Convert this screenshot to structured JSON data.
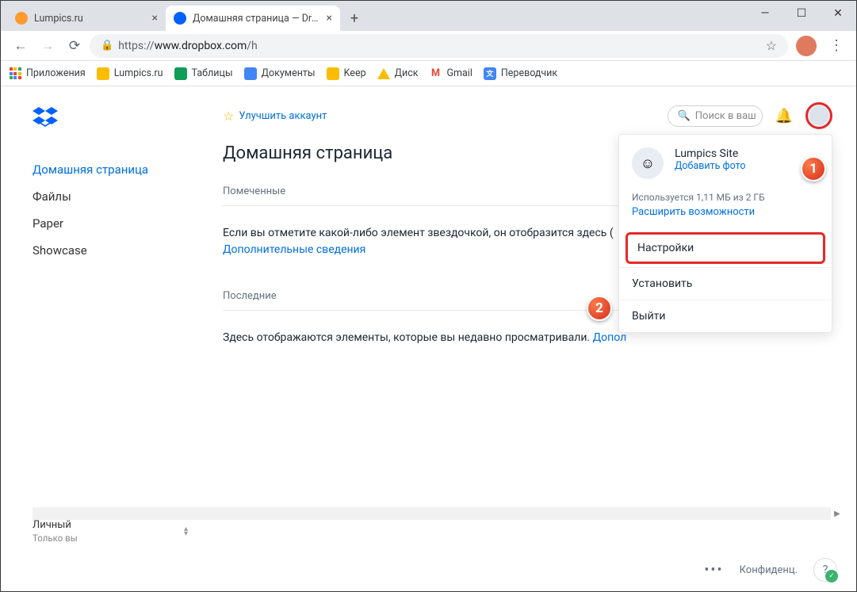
{
  "window": {
    "minimize": "—",
    "maximize": "☐",
    "close": "✕"
  },
  "tabs": [
    {
      "title": "Lumpics.ru",
      "active": false,
      "favicon_color": "#ff9a2e"
    },
    {
      "title": "Домашняя страница — Dropbox",
      "active": true,
      "favicon_color": "#0061ff"
    }
  ],
  "new_tab_glyph": "+",
  "toolbar": {
    "back": "←",
    "forward": "→",
    "reload": "⟳",
    "star": "☆",
    "menu": "⋮"
  },
  "address": {
    "scheme": "https://",
    "host": "www.dropbox.com",
    "path": "/h"
  },
  "bookmarks": [
    {
      "label": "Приложения",
      "kind": "apps"
    },
    {
      "label": "Lumpics.ru",
      "kind": "yellow"
    },
    {
      "label": "Таблицы",
      "kind": "sheets"
    },
    {
      "label": "Документы",
      "kind": "docs"
    },
    {
      "label": "Keep",
      "kind": "keep"
    },
    {
      "label": "Диск",
      "kind": "drive"
    },
    {
      "label": "Gmail",
      "kind": "gmail"
    },
    {
      "label": "Переводчик",
      "kind": "translate"
    }
  ],
  "sidebar": {
    "items": [
      "Домашняя страница",
      "Файлы",
      "Paper",
      "Showcase"
    ],
    "personal": "Личный",
    "personal_sub": "Только вы"
  },
  "upgrade_label": "Улучшить аккаунт",
  "search_placeholder": "Поиск в ваш",
  "page_title": "Домашняя страница",
  "starred_label": "Помеченные",
  "starred_body": "Если вы отметите какой-либо элемент звездочкой, он отобразится здесь (",
  "starred_link": "Дополнительные сведения",
  "recent_label": "Последние",
  "recent_body": "Здесь отображаются элементы, которые вы недавно просматривали. ",
  "recent_link": "Допол",
  "dropdown": {
    "user_name": "Lumpics Site",
    "add_photo": "Добавить фото",
    "storage": "Используется 1,11 МБ из 2 ГБ",
    "upgrade": "Расширить возможности",
    "settings": "Настройки",
    "install": "Установить",
    "logout": "Выйти"
  },
  "footer": {
    "privacy": "Конфиденц.",
    "help": "?"
  },
  "badges": {
    "one": "1",
    "two": "2"
  }
}
